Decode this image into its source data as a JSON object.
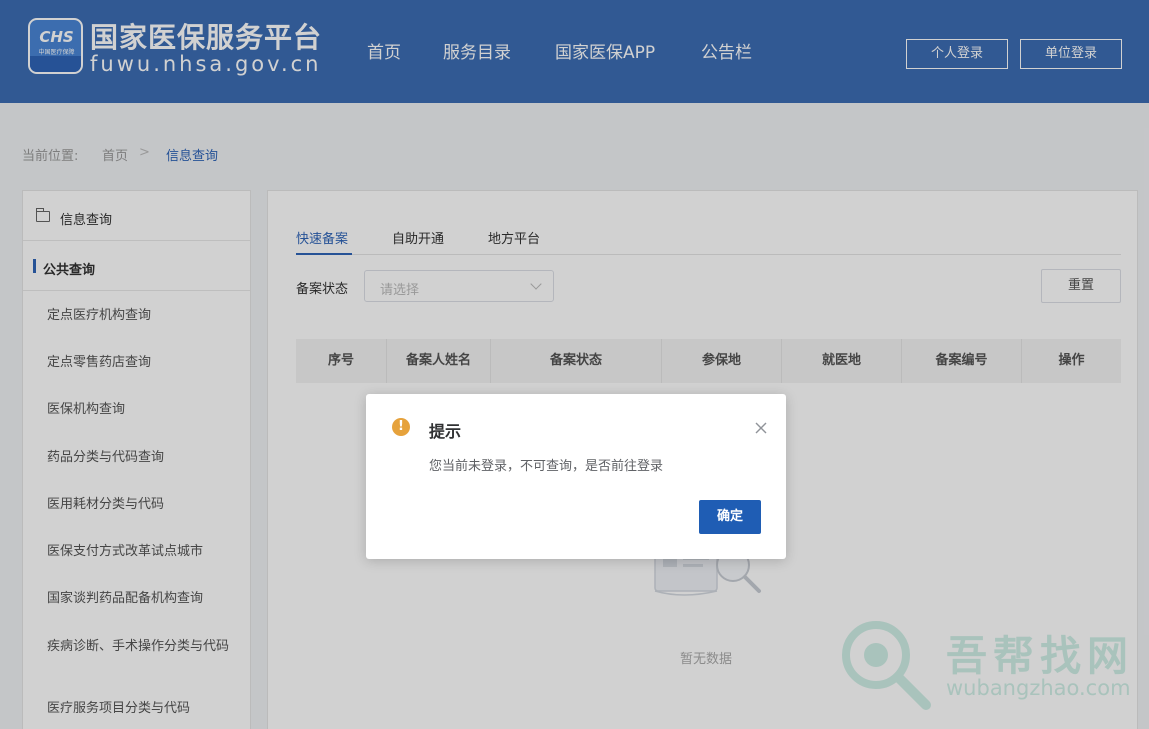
{
  "header": {
    "logo_badge": "CHS",
    "logo_badge_sub": "中国医疗保障",
    "site_title": "国家医保服务平台",
    "site_domain": "fuwu.nhsa.gov.cn",
    "nav": [
      "首页",
      "服务目录",
      "国家医保APP",
      "公告栏"
    ],
    "buttons": {
      "personal_login": "个人登录",
      "unit_login": "单位登录"
    },
    "bg_color": "#3c6db4"
  },
  "breadcrumb": {
    "prefix": "当前位置:",
    "home": "首页",
    "separator": ">",
    "current": "信息查询"
  },
  "sidebar": {
    "title": "信息查询",
    "group": "公共查询",
    "items": [
      "定点医疗机构查询",
      "定点零售药店查询",
      "医保机构查询",
      "药品分类与代码查询",
      "医用耗材分类与代码",
      "医保支付方式改革试点城市",
      "国家谈判药品配备机构查询",
      "疾病诊断、手术操作分类与代码",
      "医疗服务项目分类与代码"
    ]
  },
  "main": {
    "tabs": [
      "快速备案",
      "自助开通",
      "地方平台"
    ],
    "active_tab": "快速备案",
    "filter": {
      "label": "备案状态",
      "placeholder": "请选择",
      "reset": "重置"
    },
    "table": {
      "columns": [
        "序号",
        "备案人姓名",
        "备案状态",
        "参保地",
        "就医地",
        "备案编号",
        "操作"
      ],
      "rows": [],
      "empty_text": "暂无数据"
    }
  },
  "modal": {
    "title": "提示",
    "message": "您当前未登录，不可查询，是否前往登录",
    "confirm": "确定",
    "icon": "warning-icon",
    "confirm_color": "#1f5db4"
  },
  "watermark": {
    "text": "吾帮找网",
    "url": "wubangzhao.com"
  }
}
